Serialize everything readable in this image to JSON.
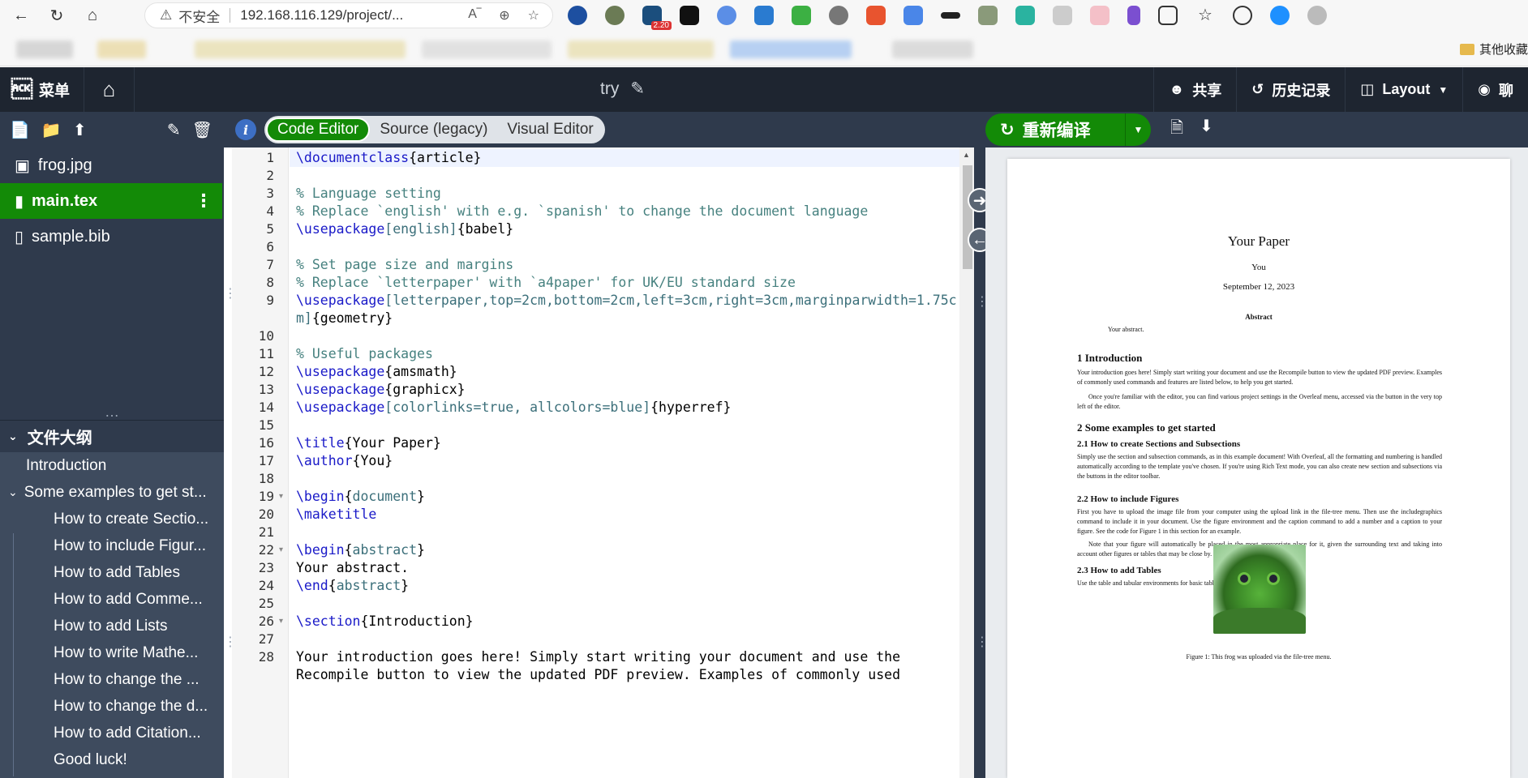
{
  "browser": {
    "security_label": "不安全",
    "url": "192.168.116.129/project/...",
    "extension_badge": "2.20",
    "bookmarks_right": "其他收藏"
  },
  "toolbar": {
    "menu_label": "菜单",
    "project_title": "try",
    "share_label": "共享",
    "history_label": "历史记录",
    "layout_label": "Layout",
    "chat_label": "聊"
  },
  "files": [
    {
      "name": "frog.jpg",
      "icon": "image-icon"
    },
    {
      "name": "main.tex",
      "icon": "file-icon",
      "active": true
    },
    {
      "name": "sample.bib",
      "icon": "book-icon"
    }
  ],
  "outline": {
    "title": "文件大纲",
    "items": [
      {
        "label": "Introduction",
        "level": 1
      },
      {
        "label": "Some examples to get st...",
        "level": 1,
        "collapsible": true
      },
      {
        "label": "How to create Sectio...",
        "level": 2
      },
      {
        "label": "How to include Figur...",
        "level": 2
      },
      {
        "label": "How to add Tables",
        "level": 2
      },
      {
        "label": "How to add Comme...",
        "level": 2
      },
      {
        "label": "How to add Lists",
        "level": 2
      },
      {
        "label": "How to write Mathe...",
        "level": 2
      },
      {
        "label": "How to change the ...",
        "level": 2
      },
      {
        "label": "How to change the d...",
        "level": 2
      },
      {
        "label": "How to add Citation...",
        "level": 2
      },
      {
        "label": "Good luck!",
        "level": 2
      }
    ]
  },
  "editor": {
    "modes": [
      "Code Editor",
      "Source (legacy)",
      "Visual Editor"
    ],
    "active_mode": "Code Editor",
    "lines": [
      {
        "n": "1",
        "segs": [
          [
            "cmd",
            "\\documentclass"
          ],
          [
            "txt",
            "{article}"
          ]
        ]
      },
      {
        "n": "2",
        "segs": []
      },
      {
        "n": "3",
        "segs": [
          [
            "cmt",
            "% Language setting"
          ]
        ]
      },
      {
        "n": "4",
        "segs": [
          [
            "cmt",
            "% Replace `english' with e.g. `spanish' to change the document language"
          ]
        ]
      },
      {
        "n": "5",
        "segs": [
          [
            "cmd",
            "\\usepackage"
          ],
          [
            "arg",
            "[english]"
          ],
          [
            "txt",
            "{babel}"
          ]
        ]
      },
      {
        "n": "6",
        "segs": []
      },
      {
        "n": "7",
        "segs": [
          [
            "cmt",
            "% Set page size and margins"
          ]
        ]
      },
      {
        "n": "8",
        "segs": [
          [
            "cmt",
            "% Replace `letterpaper' with `a4paper' for UK/EU standard size"
          ]
        ]
      },
      {
        "n": "9",
        "segs": [
          [
            "cmd",
            "\\usepackage"
          ],
          [
            "arg",
            "[letterpaper,top=2cm,bottom=2cm,left=3cm,right=3cm,marginparwidth=1.75c"
          ]
        ]
      },
      {
        "n": "",
        "segs": [
          [
            "arg",
            "m]"
          ],
          [
            "txt",
            "{geometry}"
          ]
        ]
      },
      {
        "n": "10",
        "segs": []
      },
      {
        "n": "11",
        "segs": [
          [
            "cmt",
            "% Useful packages"
          ]
        ]
      },
      {
        "n": "12",
        "segs": [
          [
            "cmd",
            "\\usepackage"
          ],
          [
            "txt",
            "{amsmath}"
          ]
        ]
      },
      {
        "n": "13",
        "segs": [
          [
            "cmd",
            "\\usepackage"
          ],
          [
            "txt",
            "{graphicx}"
          ]
        ]
      },
      {
        "n": "14",
        "segs": [
          [
            "cmd",
            "\\usepackage"
          ],
          [
            "arg",
            "[colorlinks=true, allcolors=blue]"
          ],
          [
            "txt",
            "{hyperref}"
          ]
        ]
      },
      {
        "n": "15",
        "segs": []
      },
      {
        "n": "16",
        "segs": [
          [
            "cmd",
            "\\title"
          ],
          [
            "txt",
            "{Your Paper}"
          ]
        ]
      },
      {
        "n": "17",
        "segs": [
          [
            "cmd",
            "\\author"
          ],
          [
            "txt",
            "{You}"
          ]
        ]
      },
      {
        "n": "18",
        "segs": []
      },
      {
        "n": "19",
        "segs": [
          [
            "cmd",
            "\\begin"
          ],
          [
            "txt",
            "{"
          ],
          [
            "arg",
            "document"
          ],
          [
            "txt",
            "}"
          ]
        ],
        "fold": true
      },
      {
        "n": "20",
        "segs": [
          [
            "cmd",
            "\\maketitle"
          ]
        ]
      },
      {
        "n": "21",
        "segs": []
      },
      {
        "n": "22",
        "segs": [
          [
            "cmd",
            "\\begin"
          ],
          [
            "txt",
            "{"
          ],
          [
            "arg",
            "abstract"
          ],
          [
            "txt",
            "}"
          ]
        ],
        "fold": true
      },
      {
        "n": "23",
        "segs": [
          [
            "txt",
            "Your abstract."
          ]
        ]
      },
      {
        "n": "24",
        "segs": [
          [
            "cmd",
            "\\end"
          ],
          [
            "txt",
            "{"
          ],
          [
            "arg",
            "abstract"
          ],
          [
            "txt",
            "}"
          ]
        ]
      },
      {
        "n": "25",
        "segs": []
      },
      {
        "n": "26",
        "segs": [
          [
            "cmd",
            "\\section"
          ],
          [
            "txt",
            "{Introduction}"
          ]
        ],
        "fold": true
      },
      {
        "n": "27",
        "segs": []
      },
      {
        "n": "28",
        "segs": [
          [
            "txt",
            "Your introduction goes here! Simply start writing your document and use the"
          ]
        ]
      },
      {
        "n": "",
        "segs": [
          [
            "txt",
            "Recompile button to view the updated PDF preview. Examples of commonly used"
          ]
        ]
      }
    ]
  },
  "pdf": {
    "recompile_label": "重新编译",
    "title": "Your Paper",
    "author": "You",
    "date": "September 12, 2023",
    "abstract_heading": "Abstract",
    "abstract_text": "Your abstract.",
    "sec1": "1   Introduction",
    "sec1_p1": "Your introduction goes here! Simply start writing your document and use the Recompile button to view the updated PDF preview. Examples of commonly used commands and features are listed below, to help you get started.",
    "sec1_p2": "Once you're familiar with the editor, you can find various project settings in the Overleaf menu, accessed via the button in the very top left of the editor.",
    "sec2": "2   Some examples to get started",
    "sub21": "2.1   How to create Sections and Subsections",
    "sub21_p": "Simply use the section and subsection commands, as in this example document! With Overleaf, all the formatting and numbering is handled automatically according to the template you've chosen. If you're using Rich Text mode, you can also create new section and subsections via the buttons in the editor toolbar.",
    "sub22": "2.2   How to include Figures",
    "sub22_p1": "First you have to upload the image file from your computer using the upload link in the file-tree menu. Then use the includegraphics command to include it in your document. Use the figure environment and the caption command to add a number and a caption to your figure. See the code for Figure 1 in this section for an example.",
    "sub22_p2": "Note that your figure will automatically be placed in the most appropriate place for it, given the surrounding text and taking into account other figures or tables that may be close by.",
    "sub23": "2.3   How to add Tables",
    "sub23_p": "Use the table and tabular environments for basic tables — see Table 1, for example.",
    "figure_caption": "Figure 1: This frog was uploaded via the file-tree menu."
  }
}
